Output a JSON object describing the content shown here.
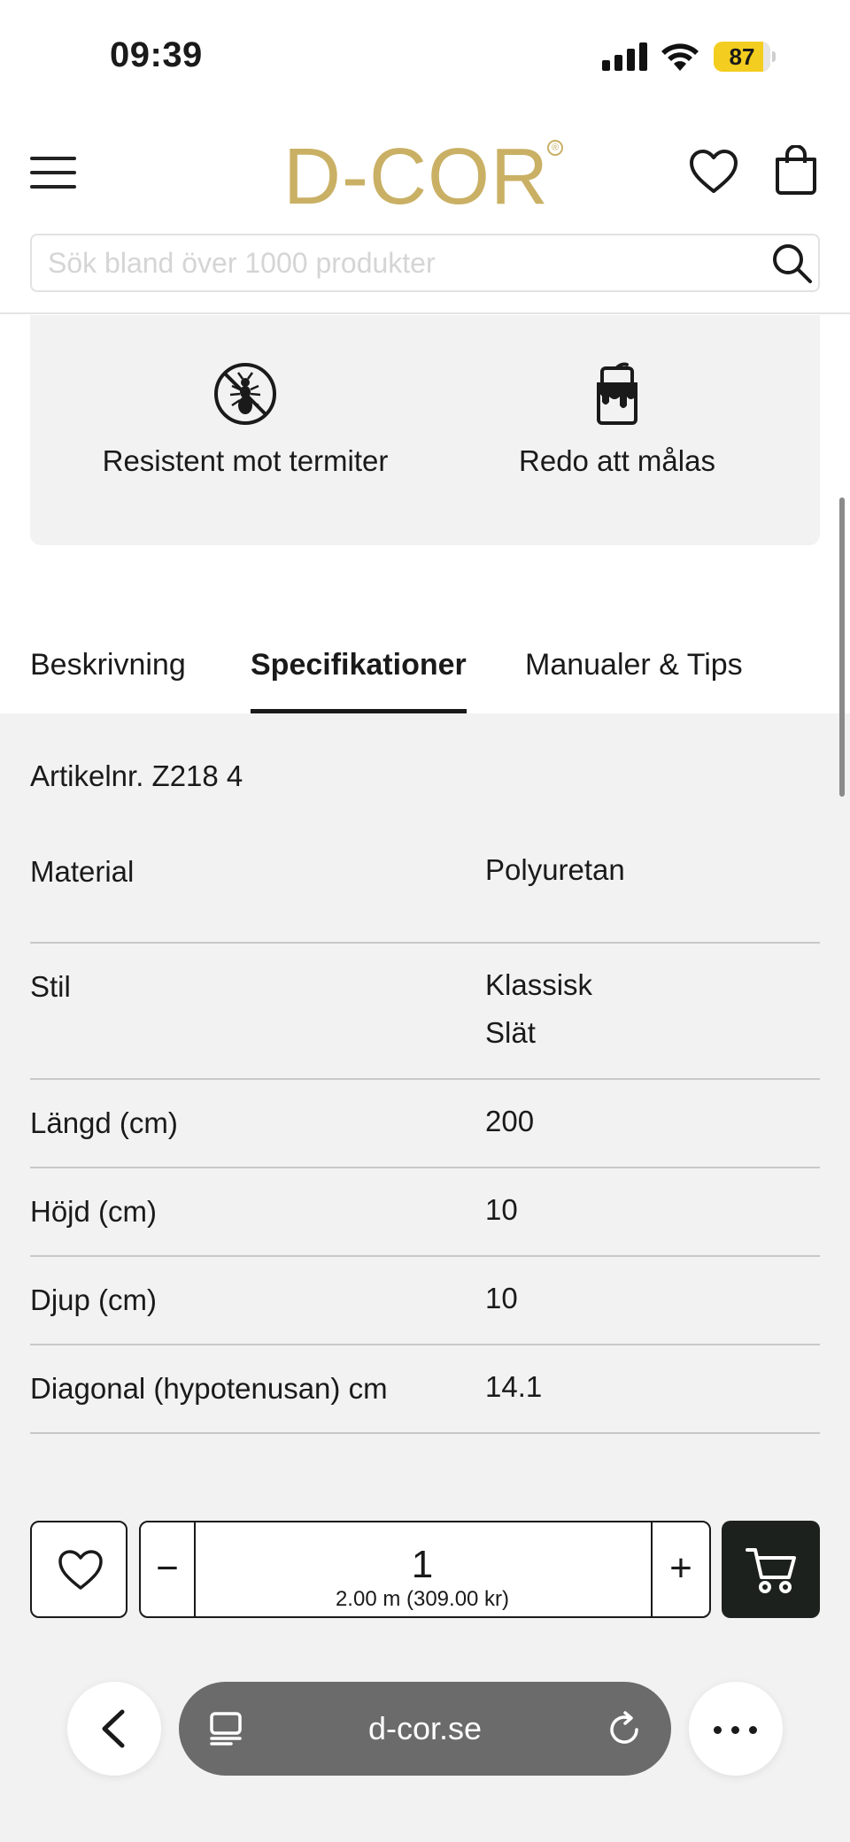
{
  "status_bar": {
    "time": "09:39",
    "battery": "87",
    "battery_level": 0.87
  },
  "header": {
    "logo": "D-COR",
    "logo_mark": "®",
    "search": {
      "placeholder": "Sök bland över 1000 produkter",
      "value": ""
    }
  },
  "features": [
    {
      "icon": "no-termite-icon",
      "label": "Resistent mot termiter"
    },
    {
      "icon": "paint-bucket-icon",
      "label": "Redo att målas"
    }
  ],
  "tabs": [
    {
      "label": "Beskrivning",
      "active": false
    },
    {
      "label": "Specifikationer",
      "active": true
    },
    {
      "label": "Manualer & Tips",
      "active": false
    }
  ],
  "specs": {
    "article": "Artikelnr. Z218 4",
    "rows": [
      {
        "label": "Material",
        "values": [
          "Polyuretan"
        ]
      },
      {
        "label": "Stil",
        "values": [
          "Klassisk",
          "Slät"
        ]
      },
      {
        "label": "Längd (cm)",
        "values": [
          "200"
        ]
      },
      {
        "label": "Höjd (cm)",
        "values": [
          "10"
        ]
      },
      {
        "label": "Djup (cm)",
        "values": [
          "10"
        ]
      },
      {
        "label": "Diagonal (hypotenusan) cm",
        "values": [
          "14.1"
        ]
      }
    ]
  },
  "purchase": {
    "minus": "−",
    "plus": "+",
    "quantity": "1",
    "subtotal": "2.00 m (309.00 kr)"
  },
  "browser": {
    "url": "d-cor.se"
  },
  "colors": {
    "brand_gold": "#c9b064",
    "cart_button": "#1d211d",
    "battery": "#f3cd1f"
  }
}
